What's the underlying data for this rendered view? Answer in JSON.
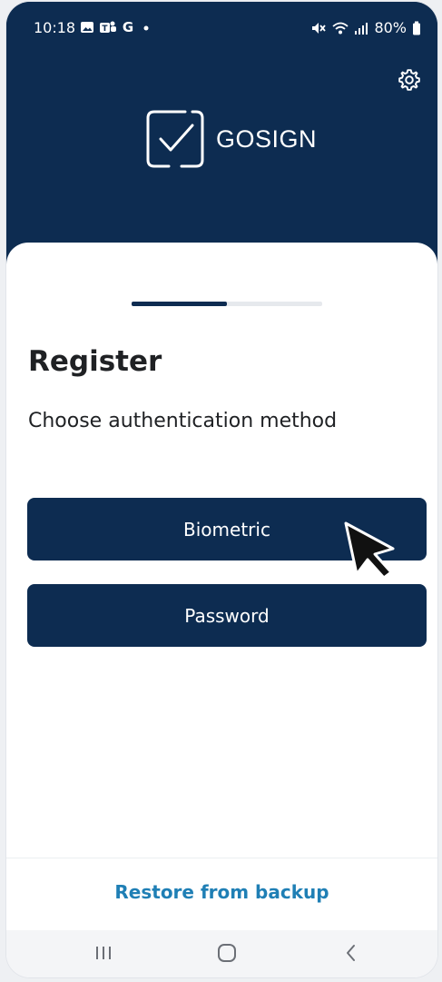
{
  "status_bar": {
    "time": "10:18",
    "left_icons": [
      "gallery-icon",
      "teams-icon",
      "google-icon",
      "dot-icon"
    ],
    "battery": "80%"
  },
  "header": {
    "brand": "GOSIGN",
    "settings_icon": "gear-icon",
    "background": "#0d2c51"
  },
  "progress": {
    "step": 1,
    "total": 2,
    "fraction": 0.5
  },
  "register": {
    "title": "Register",
    "subtitle": "Choose authentication method",
    "biometric_label": "Biometric",
    "password_label": "Password"
  },
  "footer": {
    "restore_label": "Restore from backup",
    "link_color": "#1f7fb5"
  },
  "navigation": [
    "recents-icon",
    "home-icon",
    "back-icon"
  ]
}
